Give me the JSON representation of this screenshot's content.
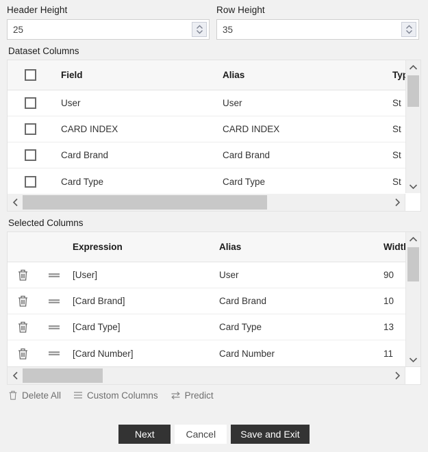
{
  "form": {
    "header_height": {
      "label": "Header Height",
      "value": "25"
    },
    "row_height": {
      "label": "Row Height",
      "value": "35"
    }
  },
  "dataset_columns": {
    "label": "Dataset Columns",
    "headers": {
      "check": "",
      "field": "Field",
      "alias": "Alias",
      "type": "Type"
    },
    "rows": [
      {
        "field": "User",
        "alias": "User",
        "type": "St"
      },
      {
        "field": "CARD INDEX",
        "alias": "CARD INDEX",
        "type": "St"
      },
      {
        "field": "Card Brand",
        "alias": "Card Brand",
        "type": "St"
      },
      {
        "field": "Card Type",
        "alias": "Card Type",
        "type": "St"
      }
    ]
  },
  "selected_columns": {
    "label": "Selected Columns",
    "headers": {
      "expression": "Expression",
      "alias": "Alias",
      "width": "Widtl"
    },
    "rows": [
      {
        "expression": "[User]",
        "alias": "User",
        "width": "90"
      },
      {
        "expression": "[Card Brand]",
        "alias": "Card Brand",
        "width": "10"
      },
      {
        "expression": "[Card Type]",
        "alias": "Card Type",
        "width": "13"
      },
      {
        "expression": "[Card Number]",
        "alias": "Card Number",
        "width": "11"
      }
    ]
  },
  "actions": {
    "delete_all": "Delete All",
    "custom_columns": "Custom Columns",
    "predict": "Predict"
  },
  "footer": {
    "next": "Next",
    "cancel": "Cancel",
    "save_and_exit": "Save and Exit"
  },
  "colors": {
    "page_bg": "#f1f1f1",
    "grid_bg": "#ffffff",
    "header_bg": "#f7f7f7",
    "button_dark": "#333333",
    "scroll_thumb": "#c8c8c8"
  }
}
